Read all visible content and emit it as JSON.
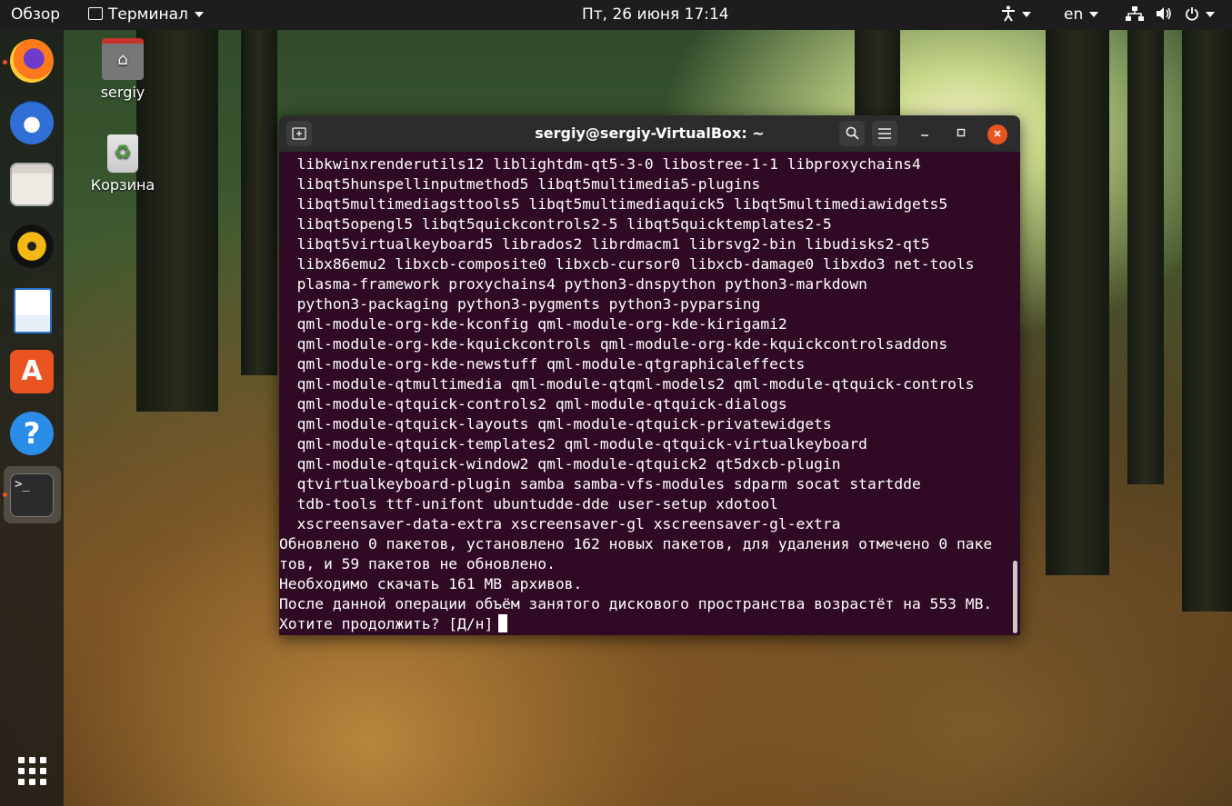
{
  "topbar": {
    "activities": "Обзор",
    "app_menu": "Терминал",
    "clock": "Пт, 26 июня  17:14",
    "lang": "en",
    "icons": [
      "accessibility-icon",
      "network-icon",
      "volume-icon",
      "power-icon"
    ]
  },
  "dock": {
    "apps": [
      "firefox-icon",
      "thunderbird-icon",
      "files-icon",
      "rhythmbox-icon",
      "libreoffice-writer-icon",
      "software-center-icon",
      "help-icon",
      "terminal-icon"
    ],
    "show_apps": "show-applications-icon"
  },
  "desktop": {
    "home_label": "sergiy",
    "trash_label": "Корзина"
  },
  "terminal": {
    "title": "sergiy@sergiy-VirtualBox: ~",
    "lines": [
      "  libkwinxrenderutils12 liblightdm-qt5-3-0 libostree-1-1 libproxychains4",
      "  libqt5hunspellinputmethod5 libqt5multimedia5-plugins",
      "  libqt5multimediagsttools5 libqt5multimediaquick5 libqt5multimediawidgets5",
      "  libqt5opengl5 libqt5quickcontrols2-5 libqt5quicktemplates2-5",
      "  libqt5virtualkeyboard5 librados2 librdmacm1 librsvg2-bin libudisks2-qt5",
      "  libx86emu2 libxcb-composite0 libxcb-cursor0 libxcb-damage0 libxdo3 net-tools",
      "  plasma-framework proxychains4 python3-dnspython python3-markdown",
      "  python3-packaging python3-pygments python3-pyparsing",
      "  qml-module-org-kde-kconfig qml-module-org-kde-kirigami2",
      "  qml-module-org-kde-kquickcontrols qml-module-org-kde-kquickcontrolsaddons",
      "  qml-module-org-kde-newstuff qml-module-qtgraphicaleffects",
      "  qml-module-qtmultimedia qml-module-qtqml-models2 qml-module-qtquick-controls",
      "  qml-module-qtquick-controls2 qml-module-qtquick-dialogs",
      "  qml-module-qtquick-layouts qml-module-qtquick-privatewidgets",
      "  qml-module-qtquick-templates2 qml-module-qtquick-virtualkeyboard",
      "  qml-module-qtquick-window2 qml-module-qtquick2 qt5dxcb-plugin",
      "  qtvirtualkeyboard-plugin samba samba-vfs-modules sdparm socat startdde",
      "  tdb-tools ttf-unifont ubuntudde-dde user-setup xdotool",
      "  xscreensaver-data-extra xscreensaver-gl xscreensaver-gl-extra",
      "Обновлено 0 пакетов, установлено 162 новых пакетов, для удаления отмечено 0 паке",
      "тов, и 59 пакетов не обновлено.",
      "Необходимо скачать 161 MB архивов.",
      "После данной операции объём занятого дискового пространства возрастёт на 553 MB.",
      "Хотите продолжить? [Д/н]"
    ]
  }
}
